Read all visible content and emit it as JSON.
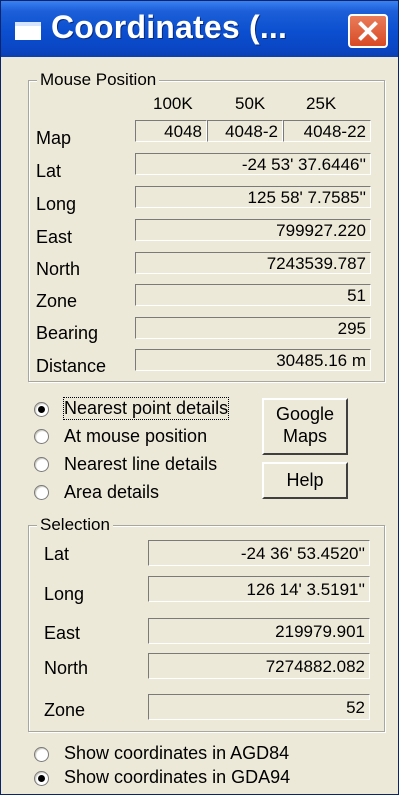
{
  "window": {
    "title": "Coordinates (..."
  },
  "mouse_position": {
    "caption": "Mouse Position",
    "columns": [
      "100K",
      "50K",
      "25K"
    ],
    "map": {
      "label": "Map",
      "v100k": "4048",
      "v50k": "4048-2",
      "v25k": "4048-22"
    },
    "rows": [
      {
        "label": "Lat",
        "value": "-24 53' 37.6446''"
      },
      {
        "label": "Long",
        "value": "125 58' 7.7585''"
      },
      {
        "label": "East",
        "value": "799927.220"
      },
      {
        "label": "North",
        "value": "7243539.787"
      },
      {
        "label": "Zone",
        "value": "51"
      },
      {
        "label": "Bearing",
        "value": "295"
      },
      {
        "label": "Distance",
        "value": "30485.16 m"
      }
    ]
  },
  "detail_options": [
    {
      "label": "Nearest point details",
      "selected": true
    },
    {
      "label": "At mouse position",
      "selected": false
    },
    {
      "label": "Nearest line details",
      "selected": false
    },
    {
      "label": "Area details",
      "selected": false
    }
  ],
  "buttons": {
    "google_maps_line1": "Google",
    "google_maps_line2": "Maps",
    "help": "Help"
  },
  "selection": {
    "caption": "Selection",
    "rows": [
      {
        "label": "Lat",
        "value": "-24 36' 53.4520''"
      },
      {
        "label": "Long",
        "value": "126 14' 3.5191''"
      },
      {
        "label": "East",
        "value": "219979.901"
      },
      {
        "label": "North",
        "value": "7274882.082"
      },
      {
        "label": "Zone",
        "value": "52"
      }
    ]
  },
  "datum_options": [
    {
      "label": "Show coordinates in AGD84",
      "selected": false
    },
    {
      "label": "Show coordinates in GDA94",
      "selected": true
    }
  ]
}
